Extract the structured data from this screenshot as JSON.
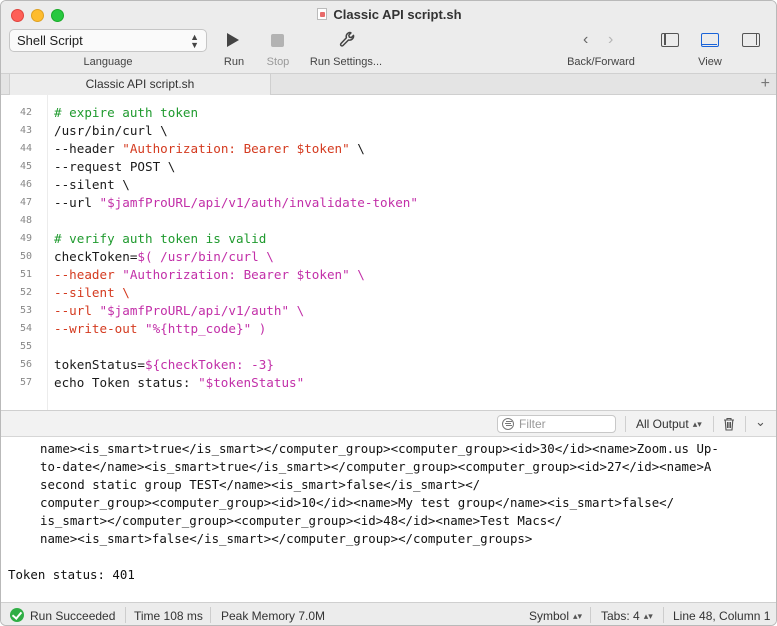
{
  "window": {
    "title": "Classic API script.sh"
  },
  "toolbar": {
    "language_value": "Shell Script",
    "language_label": "Language",
    "run_label": "Run",
    "stop_label": "Stop",
    "run_settings_label": "Run Settings...",
    "back_forward_label": "Back/Forward",
    "view_label": "View"
  },
  "tabs": [
    {
      "label": "Classic API script.sh"
    }
  ],
  "editor": {
    "lines": [
      {
        "n": "42",
        "segs": [
          {
            "t": "# expire auth token",
            "c": "c-com"
          }
        ]
      },
      {
        "n": "43",
        "segs": [
          {
            "t": "/usr/bin/curl \\",
            "c": "c-def"
          }
        ]
      },
      {
        "n": "44",
        "segs": [
          {
            "t": "--header ",
            "c": "c-def"
          },
          {
            "t": "\"Authorization: Bearer $token\"",
            "c": "c-red"
          },
          {
            "t": " \\",
            "c": "c-def"
          }
        ]
      },
      {
        "n": "45",
        "segs": [
          {
            "t": "--request POST \\",
            "c": "c-def"
          }
        ]
      },
      {
        "n": "46",
        "segs": [
          {
            "t": "--silent \\",
            "c": "c-def"
          }
        ]
      },
      {
        "n": "47",
        "segs": [
          {
            "t": "--url ",
            "c": "c-def"
          },
          {
            "t": "\"$jamfProURL/api/v1/auth/invalidate-token\"",
            "c": "c-str"
          }
        ]
      },
      {
        "n": "48",
        "segs": [
          {
            "t": "",
            "c": "c-def"
          }
        ]
      },
      {
        "n": "49",
        "segs": [
          {
            "t": "# verify auth token is valid",
            "c": "c-com"
          }
        ]
      },
      {
        "n": "50",
        "segs": [
          {
            "t": "checkToken=",
            "c": "c-def"
          },
          {
            "t": "$( /usr/bin/curl \\",
            "c": "c-str"
          }
        ]
      },
      {
        "n": "51",
        "segs": [
          {
            "t": "--header ",
            "c": "c-red"
          },
          {
            "t": "\"Authorization: Bearer $token\"",
            "c": "c-str"
          },
          {
            "t": " \\",
            "c": "c-str"
          }
        ]
      },
      {
        "n": "52",
        "segs": [
          {
            "t": "--silent \\",
            "c": "c-red"
          }
        ]
      },
      {
        "n": "53",
        "segs": [
          {
            "t": "--url ",
            "c": "c-red"
          },
          {
            "t": "\"$jamfProURL/api/v1/auth\"",
            "c": "c-str"
          },
          {
            "t": " \\",
            "c": "c-str"
          }
        ]
      },
      {
        "n": "54",
        "segs": [
          {
            "t": "--write-out ",
            "c": "c-red"
          },
          {
            "t": "\"%{http_code}\" )",
            "c": "c-str"
          }
        ]
      },
      {
        "n": "55",
        "segs": [
          {
            "t": "",
            "c": "c-def"
          }
        ]
      },
      {
        "n": "56",
        "segs": [
          {
            "t": "tokenStatus=",
            "c": "c-def"
          },
          {
            "t": "${checkToken: -3}",
            "c": "c-str"
          }
        ]
      },
      {
        "n": "57",
        "segs": [
          {
            "t": "echo Token status: ",
            "c": "c-def"
          },
          {
            "t": "\"$tokenStatus\"",
            "c": "c-str"
          }
        ]
      }
    ]
  },
  "output_bar": {
    "filter_placeholder": "Filter",
    "output_select": "All Output"
  },
  "console": {
    "lines": [
      "name><is_smart>true</is_smart></computer_group><computer_group><id>30</id><name>Zoom.us Up-",
      "to-date</name><is_smart>true</is_smart></computer_group><computer_group><id>27</id><name>A",
      "second static group TEST</name><is_smart>false</is_smart></",
      "computer_group><computer_group><id>10</id><name>My test group</name><is_smart>false</",
      "is_smart></computer_group><computer_group><id>48</id><name>Test Macs</",
      "name><is_smart>false</is_smart></computer_group></computer_groups>",
      "",
      "Token status: 401"
    ]
  },
  "status": {
    "run_result": "Run Succeeded",
    "time": "Time 108 ms",
    "memory": "Peak Memory 7.0M",
    "symbol": "Symbol",
    "tabs": "Tabs: 4",
    "position": "Line 48, Column 1"
  }
}
